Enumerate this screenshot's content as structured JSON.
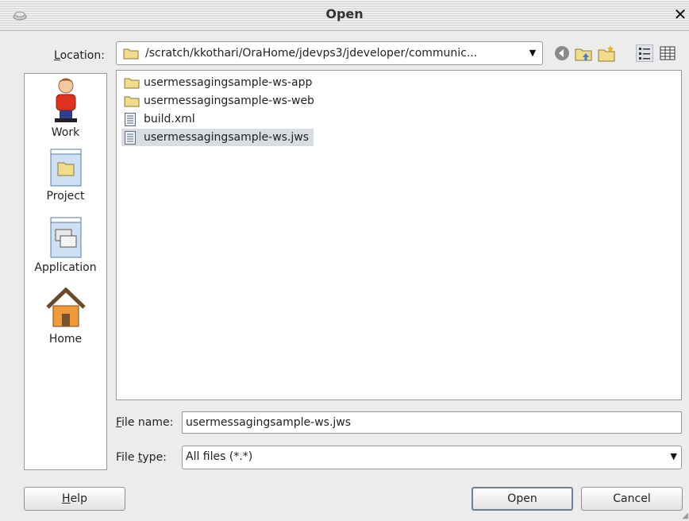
{
  "window": {
    "title": "Open",
    "close_glyph": "✕"
  },
  "location": {
    "label_pre": "",
    "label_mnemonic": "L",
    "label_post": "ocation:",
    "path": "/scratch/kkothari/OraHome/jdevps3/jdeveloper/communic...",
    "dropdown_glyph": "▼"
  },
  "toolbar": {
    "icons": [
      "back-icon",
      "up-folder-icon",
      "new-folder-icon",
      "list-view-icon",
      "details-view-icon"
    ]
  },
  "places": [
    {
      "label": "Work",
      "icon": "person-icon"
    },
    {
      "label": "Project",
      "icon": "project-window-icon"
    },
    {
      "label": "Application",
      "icon": "application-window-icon"
    },
    {
      "label": "Home",
      "icon": "house-icon"
    }
  ],
  "files": [
    {
      "name": "usermessagingsample-ws-app",
      "type": "folder"
    },
    {
      "name": "usermessagingsample-ws-web",
      "type": "folder"
    },
    {
      "name": "build.xml",
      "type": "file"
    },
    {
      "name": "usermessagingsample-ws.jws",
      "type": "file",
      "selected": true
    }
  ],
  "filename": {
    "label_mnemonic": "F",
    "label_post": "ile name:",
    "value": "usermessagingsample-ws.jws"
  },
  "filetype": {
    "label_pre": "File ",
    "label_mnemonic": "t",
    "label_post": "ype:",
    "value": "All files (*.*)",
    "dropdown_glyph": "▼"
  },
  "buttons": {
    "help_mnemonic": "H",
    "help_rest": "elp",
    "open": "Open",
    "cancel": "Cancel"
  },
  "colors": {
    "folder": "#f2dc8c",
    "selection": "#d9dde3",
    "accent": "#6f7f92"
  }
}
